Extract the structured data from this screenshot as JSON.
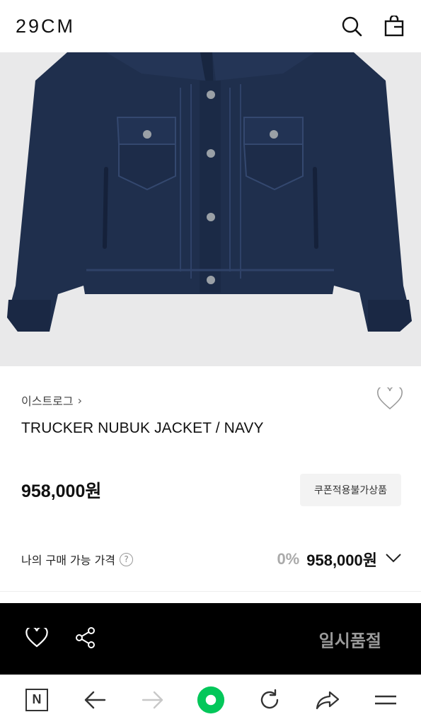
{
  "header": {
    "logo": "29CM",
    "icons": [
      "search-icon",
      "shopping-bag-icon"
    ]
  },
  "product": {
    "brand": "이스트로그",
    "brand_chevron": "›",
    "title": "TRUCKER NUBUK JACKET / NAVY",
    "price": "958,000원",
    "coupon_badge": "쿠폰적용불가상품",
    "my_price_label": "나의 구매 가능 가격",
    "help_mark": "?",
    "discount_percent": "0%",
    "my_price": "958,000원"
  },
  "action_bar": {
    "status_label": "일시품절",
    "icons": [
      "heart-icon",
      "share-icon"
    ]
  },
  "browser_nav": {
    "n_label": "N",
    "icons": [
      "naver-n-icon",
      "back-arrow-icon",
      "forward-arrow-icon",
      "green-dot-icon",
      "refresh-icon",
      "share-arrow-icon",
      "menu-icon"
    ]
  },
  "colors": {
    "jacket": "#1f2f4d",
    "action_bar_bg": "#000000",
    "soldout_text": "#9a9a9a",
    "naver_green": "#03c75a"
  }
}
